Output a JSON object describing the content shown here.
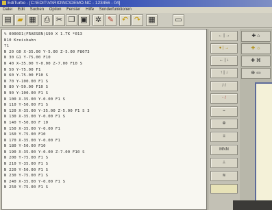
{
  "window": {
    "title": "EdiTurbo - [C:\\EDIT\\VARIO\\NC\\DEMO.NC - 123456 - 04]"
  },
  "menu": [
    "Datei",
    "Edit",
    "Suchen",
    "Option",
    "Fenster",
    "Hilfe",
    "Sonderfunktionen"
  ],
  "toolbar_icons": [
    "new-file-icon",
    "open-folder-icon",
    "save-icon",
    "print-icon",
    "cut-icon",
    "copy-icon",
    "paste-icon",
    "star-icon",
    "pencil-icon",
    "undo-icon",
    "redo-icon",
    "calculator-icon",
    "help-icon"
  ],
  "editor": {
    "lines": [
      "% 0000O1(FRAESEN)G90 X 1.TK *013",
      "N10 Kreisbahn",
      "T1",
      "N 20 G0 X-35.00 Y-5.00 Z-5.00 F8073",
      "N 30 G1 Y-75.00 F10",
      "N 40 X-35.00 Y-0.00 Z-7.00 F10 S",
      "N 50 Y-75.00 F1",
      "N 60 Y-75.00 F10 S",
      "N 70 Y-100.00 F1 S",
      "N 80 Y-50.00 F10 S",
      "N 90 Y-100.00 F1 S",
      "N 100 X-35.00 Y-0.00 F1 S",
      "N 110 Y-50.00 F1 S",
      "N 120 X-35.00 Y-35.00 Z-5.00 F1 S 3",
      "N 130 X-35.00 Y-0.00 F1 S",
      "N 140 Y-50.00 F 10",
      "N 150 X-35.00 Y-0.00 F1",
      "N 160 Y-75.00 F10",
      "N 170 X-35.00 Y-0.00 F1",
      "N 180 Y-50.00 F10",
      "N 190 X-35.00 Y-0.00 Z-7.00 F10 S",
      "N 200 Y-75.00 F1 S",
      "N 210 Y-35.00 F1 S",
      "N 220 Y-50.00 F1 S",
      "N 230 Y-75.00 F1 S",
      "N 240 X-35.00 Y-0.00 F1 S",
      "N 250 Y-75.00 F1 S"
    ]
  },
  "panel": {
    "buttons": [
      {
        "label": "← | →",
        "icon": "arrows-icon"
      },
      {
        "label": "● | →",
        "icon": "yellow-marker-icon"
      },
      {
        "label": "← | ↓",
        "icon": "arrow-down-icon"
      },
      {
        "label": "↑ | ↓",
        "icon": "updown-icon"
      },
      {
        "label": "/ /",
        "icon": "line-icon"
      },
      {
        "label": "◦ /",
        "icon": "arc-icon"
      },
      {
        "label": "≈",
        "icon": "wave-icon"
      },
      {
        "label": "⊕",
        "icon": "circle-plus-icon"
      },
      {
        "label": "≡",
        "icon": "list-icon"
      },
      {
        "label": "MNN",
        "icon": "mnn-icon"
      },
      {
        "label": "⊥",
        "icon": "perp-icon"
      },
      {
        "label": "≋",
        "icon": "pattern-icon"
      }
    ]
  },
  "canvas": {
    "buttons": [
      {
        "label": "✚ ⌂",
        "icon": "cross-icon"
      },
      {
        "label": "✚ ☼",
        "icon": "sun-icon"
      },
      {
        "label": "✚ ⌘",
        "icon": "tool-icon"
      },
      {
        "label": "⊕ ▭",
        "icon": "frame-icon"
      }
    ]
  }
}
